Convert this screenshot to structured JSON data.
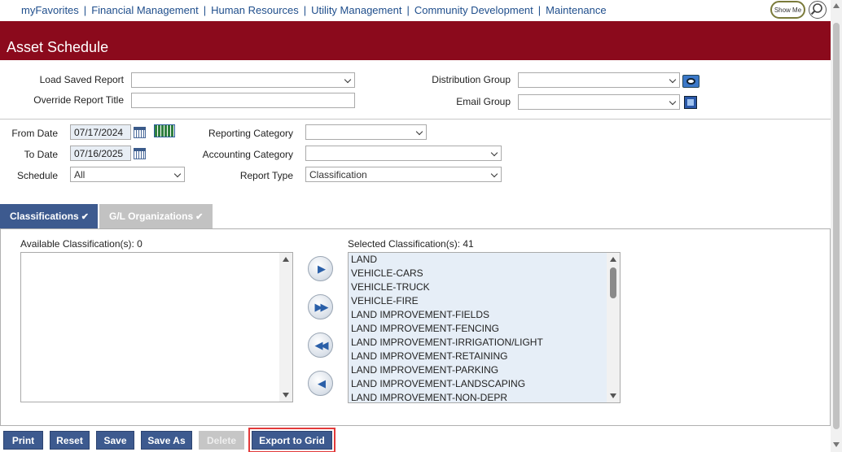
{
  "nav": {
    "links": [
      "myFavorites",
      "Financial Management",
      "Human Resources",
      "Utility Management",
      "Community Development",
      "Maintenance"
    ],
    "show_me": "Show Me"
  },
  "page": {
    "title": "Asset Schedule"
  },
  "form": {
    "load_saved_report": {
      "label": "Load Saved Report",
      "value": ""
    },
    "override_report_title": {
      "label": "Override Report Title",
      "value": ""
    },
    "distribution_group": {
      "label": "Distribution Group",
      "value": ""
    },
    "email_group": {
      "label": "Email Group",
      "value": ""
    },
    "from_date": {
      "label": "From Date",
      "value": "07/17/2024"
    },
    "to_date": {
      "label": "To Date",
      "value": "07/16/2025"
    },
    "schedule": {
      "label": "Schedule",
      "value": "All"
    },
    "reporting_category": {
      "label": "Reporting Category",
      "value": ""
    },
    "accounting_category": {
      "label": "Accounting Category",
      "value": ""
    },
    "report_type": {
      "label": "Report Type",
      "value": "Classification"
    }
  },
  "tabs": [
    {
      "label": "Classifications",
      "check": "✔"
    },
    {
      "label": "G/L Organizations",
      "check": "✔"
    }
  ],
  "classifications": {
    "available_label": "Available Classification(s): 0",
    "selected_label": "Selected Classification(s): 41",
    "selected_items": [
      "LAND",
      "VEHICLE-CARS",
      "VEHICLE-TRUCK",
      "VEHICLE-FIRE",
      "LAND IMPROVEMENT-FIELDS",
      "LAND IMPROVEMENT-FENCING",
      "LAND IMPROVEMENT-IRRIGATION/LIGHT",
      "LAND IMPROVEMENT-RETAINING",
      "LAND IMPROVEMENT-PARKING",
      "LAND IMPROVEMENT-LANDSCAPING",
      "LAND IMPROVEMENT-NON-DEPR"
    ]
  },
  "buttons": {
    "print": "Print",
    "reset": "Reset",
    "save": "Save",
    "save_as": "Save As",
    "delete": "Delete",
    "export_to_grid": "Export to Grid"
  },
  "colors": {
    "brand": "#8b0a1c",
    "accent": "#3d5a8f",
    "highlight": "#e23a3a"
  }
}
